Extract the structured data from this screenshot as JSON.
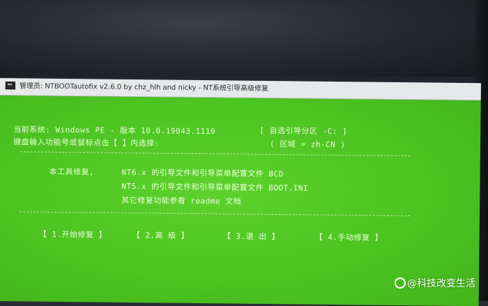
{
  "window": {
    "title": "管理员: NTBOOTautofix v2.6.0 by chz_hlh and nicky - NT系统引导高级修复"
  },
  "info": {
    "system_line": "当前系统: Windows PE - 版本 10.0.19043.1110",
    "boot_partition": "[ 自选引导分区 -C: ]",
    "prompt_line": "键盘输入功能号或鼠标点击【 】内选择:",
    "region": "( 区域 = zh-CN )"
  },
  "repair": {
    "label": "本工具修复,",
    "items": [
      "NT6.x 的引导文件和引导菜单配置文件 BCD",
      "NT5.x 的引导文件和引导菜单配置文件 BOOT.INI",
      "其它修复功能参看 readme 文档"
    ]
  },
  "menu": {
    "start": "【 1.开始修复 】",
    "advanced": "【 2.高 级 】",
    "exit": "【 3.退 出 】",
    "manual": "【 4.手动修复 】"
  },
  "watermark": {
    "text": "@科技改变生活"
  },
  "colors": {
    "console_bg": "#4cc421",
    "console_text": "#eaffd8",
    "titlebar_bg": "#e6e8ea"
  }
}
